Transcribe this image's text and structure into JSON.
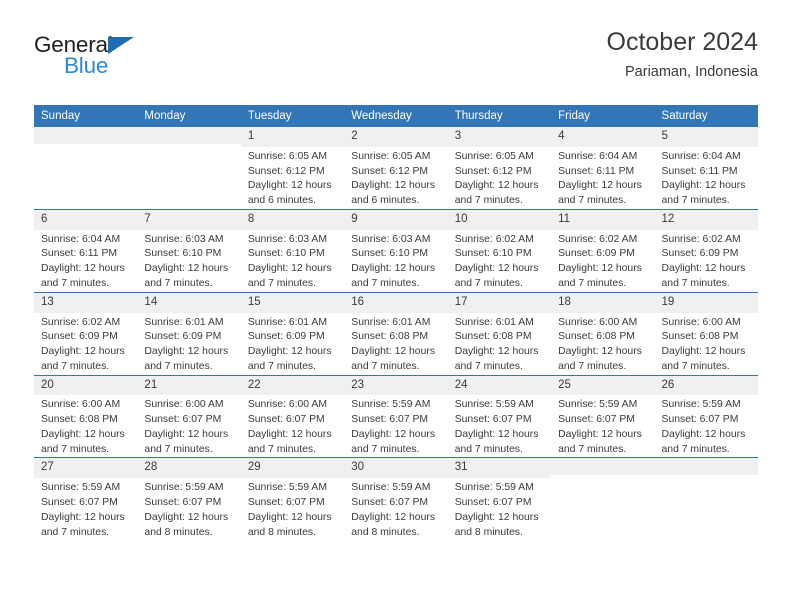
{
  "brand": {
    "name_top": "General",
    "name_bottom": "Blue",
    "triangle_color": "#1f6cb4",
    "text_color": "#231f20",
    "blue_color": "#2b8ad6"
  },
  "header": {
    "title": "October 2024",
    "subtitle": "Pariaman, Indonesia"
  },
  "colors": {
    "header_row_bg": "#3276b8",
    "daynum_bg": "#f0f0f0",
    "text": "#3b3b3b",
    "row_divider": "#3276b8"
  },
  "weekdays": [
    "Sunday",
    "Monday",
    "Tuesday",
    "Wednesday",
    "Thursday",
    "Friday",
    "Saturday"
  ],
  "weeks": [
    [
      {
        "day": "",
        "sunrise": "",
        "sunset": "",
        "daylight": ""
      },
      {
        "day": "",
        "sunrise": "",
        "sunset": "",
        "daylight": ""
      },
      {
        "day": "1",
        "sunrise": "Sunrise: 6:05 AM",
        "sunset": "Sunset: 6:12 PM",
        "daylight": "Daylight: 12 hours and 6 minutes."
      },
      {
        "day": "2",
        "sunrise": "Sunrise: 6:05 AM",
        "sunset": "Sunset: 6:12 PM",
        "daylight": "Daylight: 12 hours and 6 minutes."
      },
      {
        "day": "3",
        "sunrise": "Sunrise: 6:05 AM",
        "sunset": "Sunset: 6:12 PM",
        "daylight": "Daylight: 12 hours and 7 minutes."
      },
      {
        "day": "4",
        "sunrise": "Sunrise: 6:04 AM",
        "sunset": "Sunset: 6:11 PM",
        "daylight": "Daylight: 12 hours and 7 minutes."
      },
      {
        "day": "5",
        "sunrise": "Sunrise: 6:04 AM",
        "sunset": "Sunset: 6:11 PM",
        "daylight": "Daylight: 12 hours and 7 minutes."
      }
    ],
    [
      {
        "day": "6",
        "sunrise": "Sunrise: 6:04 AM",
        "sunset": "Sunset: 6:11 PM",
        "daylight": "Daylight: 12 hours and 7 minutes."
      },
      {
        "day": "7",
        "sunrise": "Sunrise: 6:03 AM",
        "sunset": "Sunset: 6:10 PM",
        "daylight": "Daylight: 12 hours and 7 minutes."
      },
      {
        "day": "8",
        "sunrise": "Sunrise: 6:03 AM",
        "sunset": "Sunset: 6:10 PM",
        "daylight": "Daylight: 12 hours and 7 minutes."
      },
      {
        "day": "9",
        "sunrise": "Sunrise: 6:03 AM",
        "sunset": "Sunset: 6:10 PM",
        "daylight": "Daylight: 12 hours and 7 minutes."
      },
      {
        "day": "10",
        "sunrise": "Sunrise: 6:02 AM",
        "sunset": "Sunset: 6:10 PM",
        "daylight": "Daylight: 12 hours and 7 minutes."
      },
      {
        "day": "11",
        "sunrise": "Sunrise: 6:02 AM",
        "sunset": "Sunset: 6:09 PM",
        "daylight": "Daylight: 12 hours and 7 minutes."
      },
      {
        "day": "12",
        "sunrise": "Sunrise: 6:02 AM",
        "sunset": "Sunset: 6:09 PM",
        "daylight": "Daylight: 12 hours and 7 minutes."
      }
    ],
    [
      {
        "day": "13",
        "sunrise": "Sunrise: 6:02 AM",
        "sunset": "Sunset: 6:09 PM",
        "daylight": "Daylight: 12 hours and 7 minutes."
      },
      {
        "day": "14",
        "sunrise": "Sunrise: 6:01 AM",
        "sunset": "Sunset: 6:09 PM",
        "daylight": "Daylight: 12 hours and 7 minutes."
      },
      {
        "day": "15",
        "sunrise": "Sunrise: 6:01 AM",
        "sunset": "Sunset: 6:09 PM",
        "daylight": "Daylight: 12 hours and 7 minutes."
      },
      {
        "day": "16",
        "sunrise": "Sunrise: 6:01 AM",
        "sunset": "Sunset: 6:08 PM",
        "daylight": "Daylight: 12 hours and 7 minutes."
      },
      {
        "day": "17",
        "sunrise": "Sunrise: 6:01 AM",
        "sunset": "Sunset: 6:08 PM",
        "daylight": "Daylight: 12 hours and 7 minutes."
      },
      {
        "day": "18",
        "sunrise": "Sunrise: 6:00 AM",
        "sunset": "Sunset: 6:08 PM",
        "daylight": "Daylight: 12 hours and 7 minutes."
      },
      {
        "day": "19",
        "sunrise": "Sunrise: 6:00 AM",
        "sunset": "Sunset: 6:08 PM",
        "daylight": "Daylight: 12 hours and 7 minutes."
      }
    ],
    [
      {
        "day": "20",
        "sunrise": "Sunrise: 6:00 AM",
        "sunset": "Sunset: 6:08 PM",
        "daylight": "Daylight: 12 hours and 7 minutes."
      },
      {
        "day": "21",
        "sunrise": "Sunrise: 6:00 AM",
        "sunset": "Sunset: 6:07 PM",
        "daylight": "Daylight: 12 hours and 7 minutes."
      },
      {
        "day": "22",
        "sunrise": "Sunrise: 6:00 AM",
        "sunset": "Sunset: 6:07 PM",
        "daylight": "Daylight: 12 hours and 7 minutes."
      },
      {
        "day": "23",
        "sunrise": "Sunrise: 5:59 AM",
        "sunset": "Sunset: 6:07 PM",
        "daylight": "Daylight: 12 hours and 7 minutes."
      },
      {
        "day": "24",
        "sunrise": "Sunrise: 5:59 AM",
        "sunset": "Sunset: 6:07 PM",
        "daylight": "Daylight: 12 hours and 7 minutes."
      },
      {
        "day": "25",
        "sunrise": "Sunrise: 5:59 AM",
        "sunset": "Sunset: 6:07 PM",
        "daylight": "Daylight: 12 hours and 7 minutes."
      },
      {
        "day": "26",
        "sunrise": "Sunrise: 5:59 AM",
        "sunset": "Sunset: 6:07 PM",
        "daylight": "Daylight: 12 hours and 7 minutes."
      }
    ],
    [
      {
        "day": "27",
        "sunrise": "Sunrise: 5:59 AM",
        "sunset": "Sunset: 6:07 PM",
        "daylight": "Daylight: 12 hours and 7 minutes."
      },
      {
        "day": "28",
        "sunrise": "Sunrise: 5:59 AM",
        "sunset": "Sunset: 6:07 PM",
        "daylight": "Daylight: 12 hours and 8 minutes."
      },
      {
        "day": "29",
        "sunrise": "Sunrise: 5:59 AM",
        "sunset": "Sunset: 6:07 PM",
        "daylight": "Daylight: 12 hours and 8 minutes."
      },
      {
        "day": "30",
        "sunrise": "Sunrise: 5:59 AM",
        "sunset": "Sunset: 6:07 PM",
        "daylight": "Daylight: 12 hours and 8 minutes."
      },
      {
        "day": "31",
        "sunrise": "Sunrise: 5:59 AM",
        "sunset": "Sunset: 6:07 PM",
        "daylight": "Daylight: 12 hours and 8 minutes."
      },
      {
        "day": "",
        "sunrise": "",
        "sunset": "",
        "daylight": ""
      },
      {
        "day": "",
        "sunrise": "",
        "sunset": "",
        "daylight": ""
      }
    ]
  ]
}
